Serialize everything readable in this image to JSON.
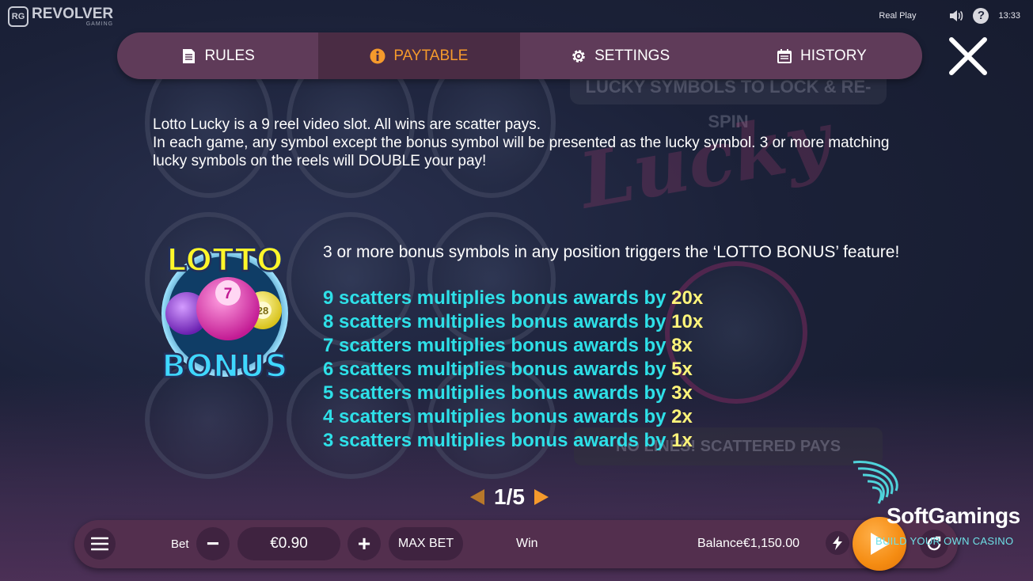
{
  "brand": {
    "badge": "RG",
    "name": "REVOLVER",
    "sub": "GAMING"
  },
  "status": {
    "mode": "Real Play",
    "time": "13:33"
  },
  "tabs": [
    {
      "label": "RULES",
      "icon": "document-icon",
      "active": false
    },
    {
      "label": "PAYTABLE",
      "icon": "info-icon",
      "active": true
    },
    {
      "label": "SETTINGS",
      "icon": "gear-icon",
      "active": false
    },
    {
      "label": "HISTORY",
      "icon": "calendar-icon",
      "active": false
    }
  ],
  "paytable": {
    "intro_line1": "Lotto Lucky is a 9 reel video slot. All wins are scatter pays.",
    "intro_line2": "In each game, any symbol except the bonus symbol will be presented as the lucky symbol. 3 or more matching lucky symbols on the reels will DOUBLE your pay!",
    "feature_image": {
      "top_text": "LOTTO",
      "bottom_text": "BONUS",
      "ball_numbers": [
        "7",
        "28"
      ]
    },
    "feature_text": "3 or more bonus symbols in any position triggers the ‘LOTTO BONUS’ feature!",
    "multipliers": [
      {
        "text": "9 scatters multiplies bonus awards by ",
        "value": "20x"
      },
      {
        "text": "8 scatters multiplies bonus awards by ",
        "value": "10x"
      },
      {
        "text": "7 scatters multiplies bonus awards by ",
        "value": "8x"
      },
      {
        "text": "6 scatters multiplies bonus awards by ",
        "value": "5x"
      },
      {
        "text": "5 scatters multiplies bonus awards by ",
        "value": "3x"
      },
      {
        "text": "4 scatters multiplies bonus awards by ",
        "value": "2x"
      },
      {
        "text": "3 scatters multiplies bonus awards by ",
        "value": "1x"
      }
    ]
  },
  "background": {
    "banner_top": "LUCKY SYMBOLS TO LOCK & RE-SPIN",
    "banner_bottom": "NO LINES! SCATTERED PAYS",
    "logo_text": "Lucky"
  },
  "pager": {
    "text": "1/5"
  },
  "bottom": {
    "bet_label": "Bet",
    "bet_value": "€0.90",
    "minus": "−",
    "plus": "+",
    "maxbet": "MAX BET",
    "win_label": "Win",
    "balance_label": "Balance",
    "balance_value": "€1,150.00"
  },
  "watermark": {
    "title": "SoftGamings",
    "subtitle": "BUILD YOUR OWN CASINO"
  },
  "colors": {
    "tab_active_text": "#f59a2c",
    "multiplier_text": "#2ee0e8",
    "multiplier_value": "#fff47a",
    "spin_button": "#f58c12"
  }
}
